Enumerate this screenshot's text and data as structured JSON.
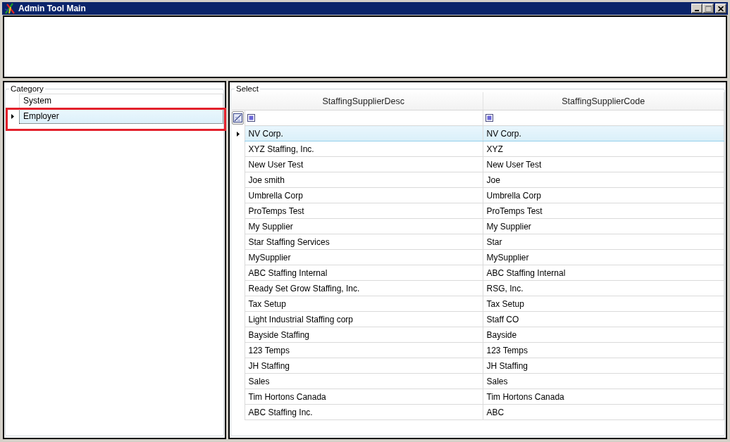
{
  "window": {
    "title": "Admin Tool Main",
    "maximize_disabled": true
  },
  "category": {
    "title": "Category",
    "items": [
      {
        "label": "System",
        "selected": false,
        "highlighted": false
      },
      {
        "label": "Employer",
        "selected": true,
        "highlighted": true
      }
    ]
  },
  "select": {
    "title": "Select",
    "columns": [
      "StaffingSupplierDesc",
      "StaffingSupplierCode"
    ],
    "rows": [
      {
        "cells": [
          "NV Corp.",
          "NV Corp."
        ],
        "selected": true
      },
      {
        "cells": [
          "XYZ Staffing, Inc.",
          "XYZ"
        ],
        "selected": false
      },
      {
        "cells": [
          "New User Test",
          "New User Test"
        ],
        "selected": false
      },
      {
        "cells": [
          "Joe smith",
          "Joe"
        ],
        "selected": false
      },
      {
        "cells": [
          "Umbrella Corp",
          "Umbrella Corp"
        ],
        "selected": false
      },
      {
        "cells": [
          "ProTemps Test",
          "ProTemps Test"
        ],
        "selected": false
      },
      {
        "cells": [
          "My Supplier",
          "My Supplier"
        ],
        "selected": false
      },
      {
        "cells": [
          "Star Staffing Services",
          "Star"
        ],
        "selected": false
      },
      {
        "cells": [
          "MySupplier",
          "MySupplier"
        ],
        "selected": false
      },
      {
        "cells": [
          "ABC Staffing Internal",
          "ABC Staffing Internal"
        ],
        "selected": false
      },
      {
        "cells": [
          "Ready Set Grow Staffing, Inc.",
          "RSG, Inc."
        ],
        "selected": false
      },
      {
        "cells": [
          "Tax Setup",
          "Tax Setup"
        ],
        "selected": false
      },
      {
        "cells": [
          "Light Industrial Staffing corp",
          "Staff CO"
        ],
        "selected": false
      },
      {
        "cells": [
          "Bayside Staffing",
          "Bayside"
        ],
        "selected": false
      },
      {
        "cells": [
          "123 Temps",
          "123 Temps"
        ],
        "selected": false
      },
      {
        "cells": [
          "JH Staffing",
          "JH Staffing"
        ],
        "selected": false
      },
      {
        "cells": [
          "Sales",
          "Sales"
        ],
        "selected": false
      },
      {
        "cells": [
          "Tim Hortons Canada",
          "Tim Hortons Canada"
        ],
        "selected": false
      },
      {
        "cells": [
          "ABC Staffing Inc.",
          "ABC"
        ],
        "selected": false
      }
    ]
  }
}
